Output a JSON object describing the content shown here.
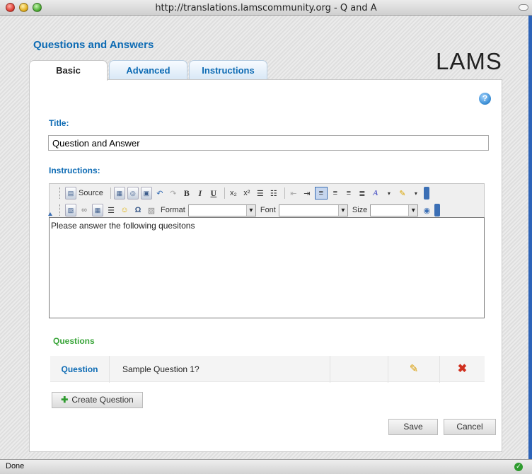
{
  "window": {
    "title": "http://translations.lamscommunity.org - Q and A"
  },
  "page": {
    "heading": "Questions and Answers",
    "logo_text": "LAMS"
  },
  "tabs": [
    {
      "label": "Basic",
      "active": true
    },
    {
      "label": "Advanced",
      "active": false
    },
    {
      "label": "Instructions",
      "active": false
    }
  ],
  "form": {
    "help_symbol": "?",
    "title_label": "Title:",
    "title_value": "Question and Answer",
    "instructions_label": "Instructions:",
    "instructions_text": "Please answer the following quesitons"
  },
  "toolbar": {
    "source_label": "Source",
    "bold_label": "B",
    "italic_label": "I",
    "underline_label": "U",
    "format_label": "Format",
    "font_label": "Font",
    "size_label": "Size"
  },
  "questions": {
    "section_label": "Questions",
    "rows": [
      {
        "label": "Question",
        "text": "Sample Question 1?"
      }
    ],
    "create_button": "Create Question"
  },
  "actions": {
    "save": "Save",
    "cancel": "Cancel"
  },
  "statusbar": {
    "text": "Done"
  },
  "colors": {
    "accent": "#0d6bb4",
    "questions_green": "#3aa53a"
  }
}
